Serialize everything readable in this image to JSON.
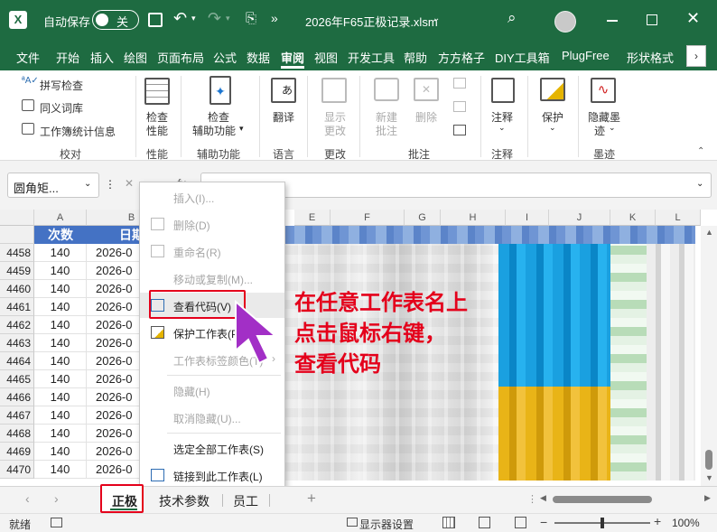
{
  "titlebar": {
    "autosave_label": "自动保存",
    "autosave_state": "关",
    "filename": "2026年F65正极记录.xlsm",
    "colors": {
      "bg": "#1e6b41",
      "fg": "#ffffff"
    }
  },
  "ribbon_tabs": [
    "文件",
    "开始",
    "插入",
    "绘图",
    "页面布局",
    "公式",
    "数据",
    "审阅",
    "视图",
    "开发工具",
    "帮助",
    "方方格子",
    "DIY工具箱",
    "PlugFree",
    "形状格式"
  ],
  "active_tab": "审阅",
  "ribbon": {
    "proofing": {
      "spell": "拼写检查",
      "thesaurus": "同义词库",
      "stats": "工作簿统计信息",
      "group": "校对"
    },
    "performance": {
      "btn_l1": "检查",
      "btn_l2": "性能",
      "group": "性能"
    },
    "accessibility": {
      "btn_l1": "检查",
      "btn_l2": "辅助功能",
      "group": "辅助功能"
    },
    "language": {
      "btn": "翻译",
      "group": "语言"
    },
    "changes": {
      "btn_l1": "显示",
      "btn_l2": "更改",
      "group": "更改"
    },
    "comments": {
      "new_l1": "新建",
      "new_l2": "批注",
      "delete": "删除",
      "group": "批注"
    },
    "notes": {
      "btn": "注释",
      "group": "注释"
    },
    "protect": {
      "btn": "保护",
      "group": ""
    },
    "ink": {
      "btn_l1": "隐藏墨",
      "btn_l2": "迹",
      "group": "墨迹"
    }
  },
  "formula_bar": {
    "name_box": "圆角矩...",
    "fx": "fx"
  },
  "grid": {
    "columns": [
      "A",
      "B",
      "E",
      "F",
      "G",
      "H",
      "I",
      "J",
      "K",
      "L"
    ],
    "header_row": {
      "a": "次数",
      "b": "日期"
    },
    "rows": [
      {
        "num": "4458",
        "a": "140",
        "b": "2026-0"
      },
      {
        "num": "4459",
        "a": "140",
        "b": "2026-0"
      },
      {
        "num": "4460",
        "a": "140",
        "b": "2026-0"
      },
      {
        "num": "4461",
        "a": "140",
        "b": "2026-0"
      },
      {
        "num": "4462",
        "a": "140",
        "b": "2026-0"
      },
      {
        "num": "4463",
        "a": "140",
        "b": "2026-0"
      },
      {
        "num": "4464",
        "a": "140",
        "b": "2026-0"
      },
      {
        "num": "4465",
        "a": "140",
        "b": "2026-0"
      },
      {
        "num": "4466",
        "a": "140",
        "b": "2026-0"
      },
      {
        "num": "4467",
        "a": "140",
        "b": "2026-0"
      },
      {
        "num": "4468",
        "a": "140",
        "b": "2026-0"
      },
      {
        "num": "4469",
        "a": "140",
        "b": "2026-0"
      },
      {
        "num": "4470",
        "a": "140",
        "b": "2026-0"
      }
    ]
  },
  "context_menu": [
    {
      "label": "插入(I)...",
      "enabled": false
    },
    {
      "label": "删除(D)",
      "enabled": false
    },
    {
      "label": "重命名(R)",
      "enabled": false
    },
    {
      "label": "移动或复制(M)...",
      "enabled": false
    },
    {
      "label": "查看代码(V)",
      "enabled": true
    },
    {
      "label": "保护工作表(P)...",
      "enabled": true
    },
    {
      "label": "工作表标签颜色(T)",
      "enabled": false
    },
    {
      "label": "隐藏(H)",
      "enabled": false
    },
    {
      "label": "取消隐藏(U)...",
      "enabled": false
    },
    {
      "label": "选定全部工作表(S)",
      "enabled": true
    },
    {
      "label": "链接到此工作表(L)",
      "enabled": true
    }
  ],
  "annotation": {
    "line1": "在任意工作表名上",
    "line2": "点击鼠标右键，",
    "line3": "查看代码",
    "color": "#e4001b"
  },
  "sheet_tabs": [
    "正极",
    "技术参数",
    "员工"
  ],
  "active_sheet": "正极",
  "status": {
    "ready": "就绪",
    "display_settings": "显示器设置",
    "zoom": "100%"
  }
}
